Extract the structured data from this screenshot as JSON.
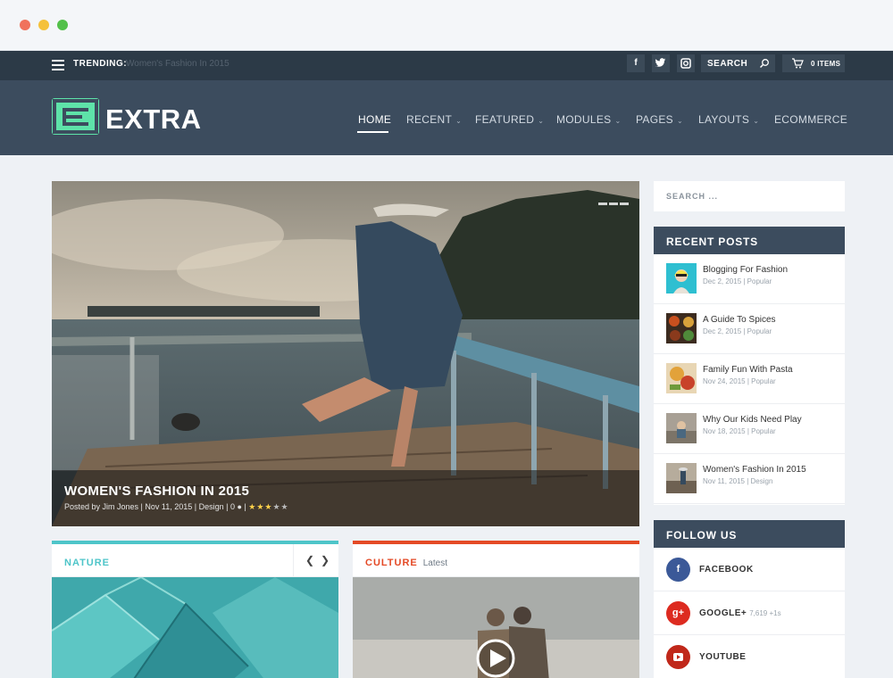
{
  "colors": {
    "accent_green": "#5ee3a9",
    "header_bg": "#3c4c5e",
    "topbar_bg": "#2c3a47",
    "nature_accent": "#4ec5c9",
    "culture_accent": "#e44a26",
    "facebook": "#3b5998",
    "googleplus": "#dd2b20",
    "youtube": "#c0281a"
  },
  "topbar": {
    "trending_label": "TRENDING:",
    "trending_value": "Women's Fashion In 2015",
    "search_label": "SEARCH",
    "cart_label": "0 ITEMS",
    "social": [
      "f",
      "t",
      "i"
    ]
  },
  "header": {
    "logo_text": "EXTRA",
    "nav": [
      {
        "label": "HOME",
        "active": true,
        "has_dropdown": false
      },
      {
        "label": "RECENT",
        "has_dropdown": true
      },
      {
        "label": "FEATURED",
        "has_dropdown": true
      },
      {
        "label": "MODULES",
        "has_dropdown": true
      },
      {
        "label": "PAGES",
        "has_dropdown": true
      },
      {
        "label": "LAYOUTS",
        "has_dropdown": true
      },
      {
        "label": "ECOMMERCE",
        "has_dropdown": false
      }
    ]
  },
  "hero": {
    "title": "WOMEN'S FASHION IN 2015",
    "meta": "Posted by Jim Jones | Nov 11, 2015 | Design | 0",
    "rating": 3,
    "rating_max": 5
  },
  "cards": [
    {
      "title": "NATURE",
      "subtitle": ""
    },
    {
      "title": "CULTURE",
      "subtitle": "Latest"
    }
  ],
  "sidebar": {
    "search_placeholder": "SEARCH ...",
    "recent_title": "RECENT POSTS",
    "recent_posts": [
      {
        "title": "Blogging For Fashion",
        "meta": "Dec 2, 2015 | Popular"
      },
      {
        "title": "A Guide To Spices",
        "meta": "Dec 2, 2015 | Popular"
      },
      {
        "title": "Family Fun With Pasta",
        "meta": "Nov 24, 2015 | Popular"
      },
      {
        "title": "Why Our Kids Need Play",
        "meta": "Nov 18, 2015 | Popular"
      },
      {
        "title": "Women's Fashion In 2015",
        "meta": "Nov 11, 2015 | Design"
      }
    ],
    "follow_title": "FOLLOW US",
    "follow": [
      {
        "name": "FACEBOOK",
        "icon": "f",
        "count": ""
      },
      {
        "name": "GOOGLE+",
        "icon": "g+",
        "count": "7,619 +1s"
      },
      {
        "name": "YOUTUBE",
        "icon": "play",
        "count": ""
      }
    ]
  }
}
